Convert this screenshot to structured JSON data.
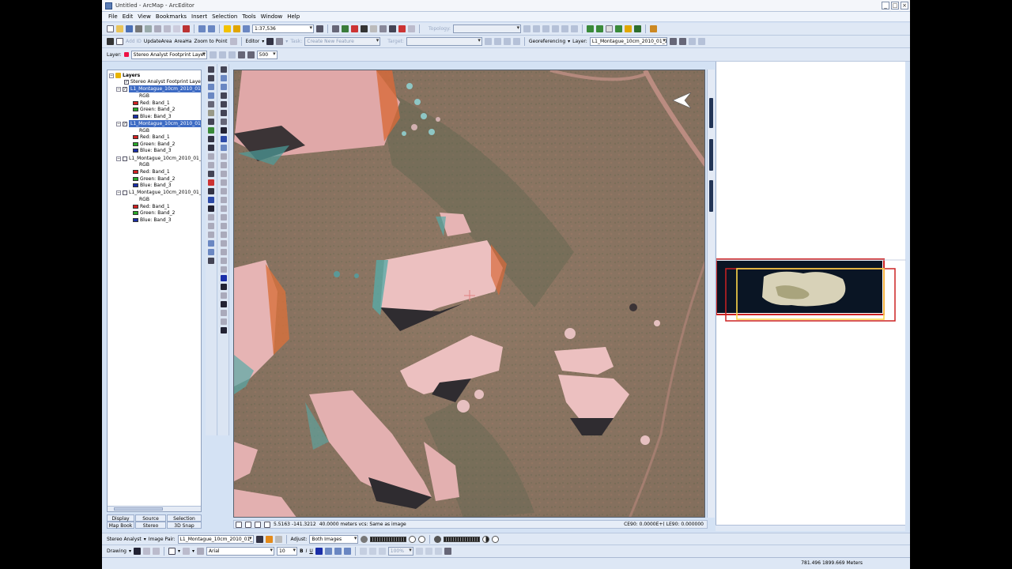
{
  "window": {
    "title": "Untitled - ArcMap - ArcEditor",
    "controls": [
      "_",
      "□",
      "×"
    ]
  },
  "menu": [
    "File",
    "Edit",
    "View",
    "Bookmarks",
    "Insert",
    "Selection",
    "Tools",
    "Window",
    "Help"
  ],
  "toolbar1": {
    "scale": "1:37,536",
    "topology_label": "Topology:"
  },
  "toolbar2": {
    "add_id": "Add ID",
    "update_area": "UpdateArea",
    "area_ha": "AreaHa",
    "zoom_to_point": "Zoom to Point",
    "editor": "Editor",
    "task_label": "Task:",
    "task_value": "Create New Feature",
    "target_label": "Target:",
    "georeferencing": "Georeferencing",
    "layer_label": "Layer:",
    "layer_value": "L1_Montague_10cm_2010_01_19_..."
  },
  "toolbar3": {
    "layer_label": "Layer:",
    "layer_value": "Stereo Analyst Footprint Layer",
    "value": "500"
  },
  "toc": {
    "root": "Layers",
    "footprint": "Stereo Analyst Footprint Layer",
    "layer_name": "L1_Montague_10cm_2010_01_1",
    "rgb": "RGB",
    "red": "Red:",
    "green": "Green:",
    "blue": "Blue:",
    "band1": "Band_1",
    "band2": "Band_2",
    "band3": "Band_3",
    "tabs": {
      "display": "Display",
      "source": "Source",
      "selection": "Selection",
      "map_book": "Map Book",
      "stereo": "Stereo",
      "snap_3d": "3D Snap"
    }
  },
  "mapstatus": {
    "coords": "5.5163 -141.3212",
    "info": "40.0000 meters  vcs: Same as image",
    "ce": "CE90: 0.0000E+( LE90: 0.000000"
  },
  "bottom1": {
    "stereo_analyst": "Stereo Analyst",
    "image_pair_label": "Image Pair:",
    "image_pair_value": "L1_Montague_10cm_2010_01_19_...",
    "adjust_label": "Adjust:",
    "adjust_value": "Both Images"
  },
  "bottom2": {
    "drawing": "Drawing",
    "font": "Arial",
    "font_size": "10",
    "bold": "B",
    "italic": "I",
    "underline": "U",
    "percent": "100%"
  },
  "statusbar": {
    "coords": "781.496  1899.669 Meters"
  },
  "colors": {
    "red_swatch": "#d22222",
    "green_swatch": "#29a829",
    "blue_swatch": "#1a2ea8",
    "selection": "#3d6bc4"
  }
}
